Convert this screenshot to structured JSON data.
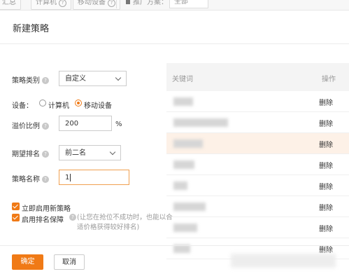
{
  "top_strip": {
    "tabs": [
      "汇总",
      "计算机",
      "移动设备"
    ],
    "filter_label": "推广方案：",
    "filter_value": "全部"
  },
  "dialog": {
    "title": "新建策略"
  },
  "form": {
    "strategy_type": {
      "label": "策略类别",
      "value": "自定义"
    },
    "device": {
      "label": "设备：",
      "options": [
        "计算机",
        "移动设备"
      ],
      "selected": "移动设备"
    },
    "premium": {
      "label": "溢价比例",
      "value": "200",
      "unit": "%"
    },
    "expected_rank": {
      "label": "期望排名",
      "value": "前二名"
    },
    "strategy_name": {
      "label": "策略名称",
      "value": "1"
    },
    "enable_now": {
      "label": "立即启用新策略",
      "checked": true
    },
    "rank_guarantee": {
      "label": "启用排名保障",
      "checked": true,
      "hint": "(让您在抢位不成功时，也能以合适价格获得较好排名)"
    }
  },
  "keyword_table": {
    "headers": [
      "关键词",
      "操作"
    ],
    "rows": [
      {
        "action": "删除"
      },
      {
        "action": "删除"
      },
      {
        "action": "删除"
      },
      {
        "action": "删除"
      },
      {
        "action": "删除"
      },
      {
        "action": "删除"
      },
      {
        "action": "删除"
      },
      {
        "action": "删除"
      }
    ]
  },
  "footer": {
    "confirm_label": "确定",
    "cancel_label": "取消"
  },
  "colors": {
    "accent": "#f07a16",
    "row_highlight": "#fdf1e7",
    "header_bg": "#f4f4f4"
  }
}
